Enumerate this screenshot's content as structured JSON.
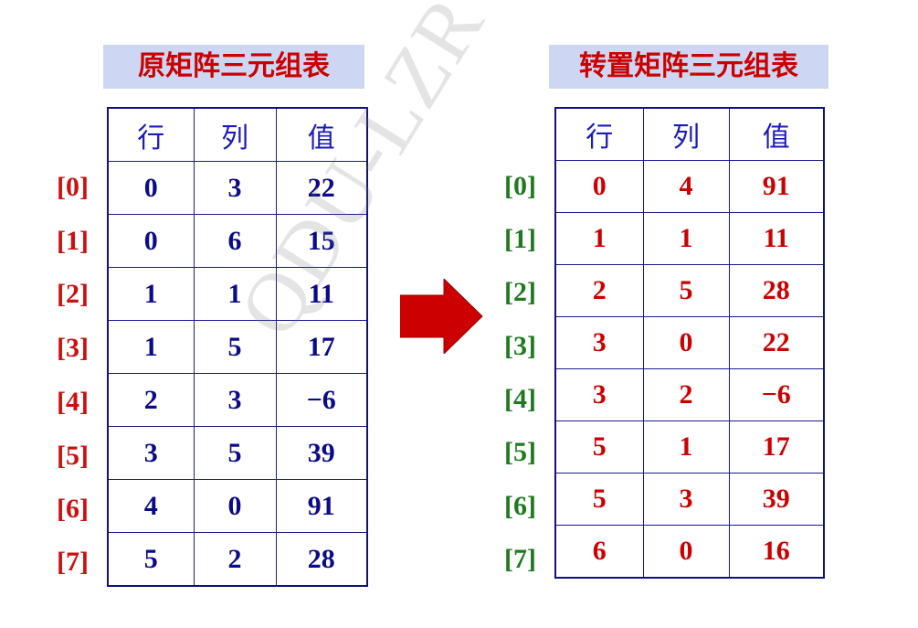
{
  "left": {
    "caption": "原矩阵三元组表",
    "headers": [
      "行",
      "列",
      "值"
    ],
    "indices": [
      "[0]",
      "[1]",
      "[2]",
      "[3]",
      "[4]",
      "[5]",
      "[6]",
      "[7]"
    ],
    "rows": [
      [
        "0",
        "3",
        "22"
      ],
      [
        "0",
        "6",
        "15"
      ],
      [
        "1",
        "1",
        "11"
      ],
      [
        "1",
        "5",
        "17"
      ],
      [
        "2",
        "3",
        "−6"
      ],
      [
        "3",
        "5",
        "39"
      ],
      [
        "4",
        "0",
        "91"
      ],
      [
        "5",
        "2",
        "28"
      ]
    ]
  },
  "right": {
    "caption": "转置矩阵三元组表",
    "headers": [
      "行",
      "列",
      "值"
    ],
    "indices": [
      "[0]",
      "[1]",
      "[2]",
      "[3]",
      "[4]",
      "[5]",
      "[6]",
      "[7]"
    ],
    "rows": [
      [
        "0",
        "4",
        "91"
      ],
      [
        "1",
        "1",
        "11"
      ],
      [
        "2",
        "5",
        "28"
      ],
      [
        "3",
        "0",
        "22"
      ],
      [
        "3",
        "2",
        "−6"
      ],
      [
        "5",
        "1",
        "17"
      ],
      [
        "5",
        "3",
        "39"
      ],
      [
        "6",
        "0",
        "16"
      ]
    ]
  },
  "watermark": "QDU-LZR",
  "colors": {
    "caption_bg": "#cdd7f3",
    "caption_text": "#cc0000",
    "left_values": "#0a0a8a",
    "right_values": "#cc0000",
    "left_index": "#cc1010",
    "right_index": "#1f7a1f",
    "header_text": "#1a1ac0",
    "arrow": "#cc0000"
  },
  "arrow_icon": "right-arrow-icon"
}
